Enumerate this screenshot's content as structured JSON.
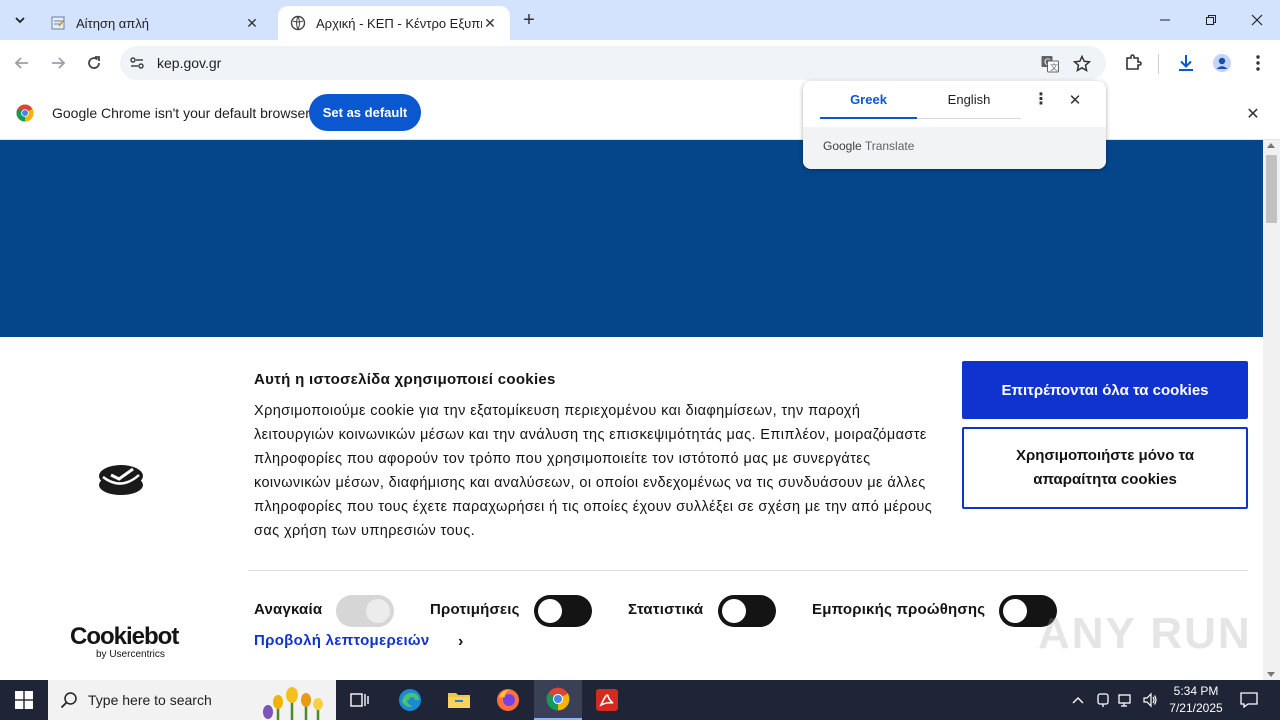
{
  "browser": {
    "tabs": [
      {
        "title": "Αίτηση απλή",
        "active": false
      },
      {
        "title": "Αρχική - ΚΕΠ - Κέντρο Εξυπηρ",
        "active": true
      }
    ],
    "url": "kep.gov.gr"
  },
  "infobar": {
    "message": "Google Chrome isn't your default browser",
    "button": "Set as default"
  },
  "translate_popup": {
    "source_lang": "Greek",
    "target_lang": "English",
    "google": "Google",
    "translate": "Translate"
  },
  "cookie_banner": {
    "title": "Αυτή η ιστοσελίδα χρησιμοποιεί cookies",
    "body": "Χρησιμοποιούμε cookie για την εξατομίκευση περιεχομένου και διαφημίσεων, την παροχή λειτουργιών κοινωνικών μέσων και την ανάλυση της επισκεψιμότητάς μας. Επιπλέον, μοιραζόμαστε πληροφορίες που αφορούν τον τρόπο που χρησιμοποιείτε τον ιστότοπό μας με συνεργάτες κοινωνικών μέσων, διαφήμισης και αναλύσεων, οι οποίοι ενδεχομένως να τις συνδυάσουν με άλλες πληροφορίες που τους έχετε παραχωρήσει ή τις οποίες έχουν συλλέξει σε σχέση με την από μέρους σας χρήση των υπηρεσιών τους.",
    "allow_all": "Επιτρέπονται όλα τα cookies",
    "necessary_only": "Χρησιμοποιήστε μόνο τα απαραίτητα cookies",
    "toggles": [
      {
        "label": "Αναγκαία",
        "enabled": true,
        "disabled": true
      },
      {
        "label": "Προτιμήσεις",
        "enabled": false
      },
      {
        "label": "Στατιστικά",
        "enabled": false
      },
      {
        "label": "Εμπορικής προώθησης",
        "enabled": false
      }
    ],
    "details_link": "Προβολή λεπτομερειών",
    "cookiebot_name": "Cookiebot",
    "cookiebot_by": "by Usercentrics"
  },
  "watermark": "ANY RUN",
  "taskbar": {
    "search_placeholder": "Type here to search",
    "time": "5:34 PM",
    "date": "7/21/2025"
  },
  "colors": {
    "hero_blue": "#05468b",
    "cookie_button_blue": "#1032cf",
    "chrome_blue": "#0b57d0",
    "tabstrip": "#d3e3fd"
  }
}
